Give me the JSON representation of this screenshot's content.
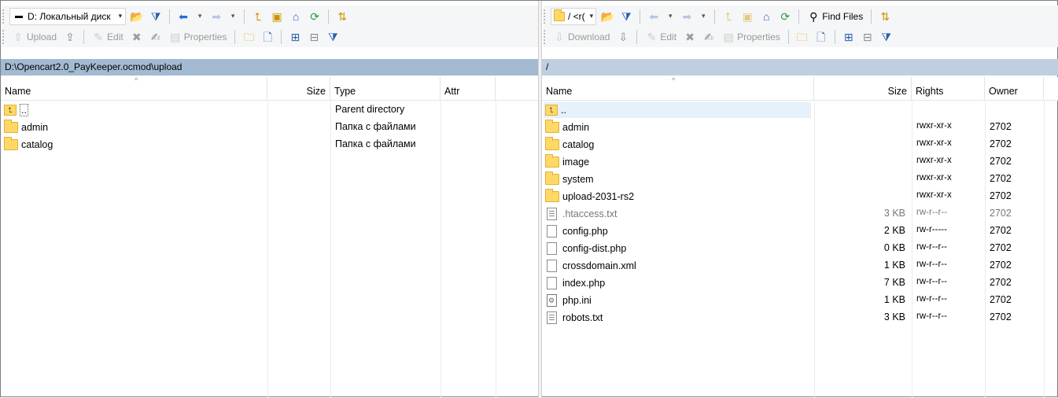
{
  "left": {
    "drive_label": "D: Локальный диск",
    "toolbar2": {
      "upload": "Upload",
      "edit": "Edit",
      "properties": "Properties"
    },
    "path": "D:\\Opencart2.0_PayKeeper.ocmod\\upload",
    "columns": {
      "name": "Name",
      "size": "Size",
      "type": "Type",
      "attr": "Attr"
    },
    "rows": [
      {
        "name": "..",
        "type": "Parent directory",
        "kind": "updir"
      },
      {
        "name": "admin",
        "type": "Папка с файлами",
        "kind": "folder"
      },
      {
        "name": "catalog",
        "type": "Папка с файлами",
        "kind": "folder"
      }
    ]
  },
  "right": {
    "path_combo": "/ <r(",
    "find_files": "Find Files",
    "toolbar2": {
      "download": "Download",
      "edit": "Edit",
      "properties": "Properties"
    },
    "path": "/",
    "columns": {
      "name": "Name",
      "size": "Size",
      "rights": "Rights",
      "owner": "Owner"
    },
    "rows": [
      {
        "name": "..",
        "size": "",
        "rights": "",
        "owner": "",
        "kind": "updir"
      },
      {
        "name": "admin",
        "size": "",
        "rights": "rwxr-xr-x",
        "owner": "2702",
        "kind": "folder"
      },
      {
        "name": "catalog",
        "size": "",
        "rights": "rwxr-xr-x",
        "owner": "2702",
        "kind": "folder"
      },
      {
        "name": "image",
        "size": "",
        "rights": "rwxr-xr-x",
        "owner": "2702",
        "kind": "folder"
      },
      {
        "name": "system",
        "size": "",
        "rights": "rwxr-xr-x",
        "owner": "2702",
        "kind": "folder"
      },
      {
        "name": "upload-2031-rs2",
        "size": "",
        "rights": "rwxr-xr-x",
        "owner": "2702",
        "kind": "folder"
      },
      {
        "name": ".htaccess.txt",
        "size": "3 KB",
        "rights": "rw-r--r--",
        "owner": "2702",
        "kind": "text-hidden"
      },
      {
        "name": "config.php",
        "size": "2 KB",
        "rights": "rw-r-----",
        "owner": "2702",
        "kind": "file"
      },
      {
        "name": "config-dist.php",
        "size": "0 KB",
        "rights": "rw-r--r--",
        "owner": "2702",
        "kind": "file"
      },
      {
        "name": "crossdomain.xml",
        "size": "1 KB",
        "rights": "rw-r--r--",
        "owner": "2702",
        "kind": "file"
      },
      {
        "name": "index.php",
        "size": "7 KB",
        "rights": "rw-r--r--",
        "owner": "2702",
        "kind": "file"
      },
      {
        "name": "php.ini",
        "size": "1 KB",
        "rights": "rw-r--r--",
        "owner": "2702",
        "kind": "ini"
      },
      {
        "name": "robots.txt",
        "size": "3 KB",
        "rights": "rw-r--r--",
        "owner": "2702",
        "kind": "text"
      }
    ]
  },
  "colors": {
    "left_path_bar": "#a2bbd2",
    "right_path_bar": "#bfcfdf",
    "folder": "#ffd865",
    "selection": "#e5f1fb"
  }
}
